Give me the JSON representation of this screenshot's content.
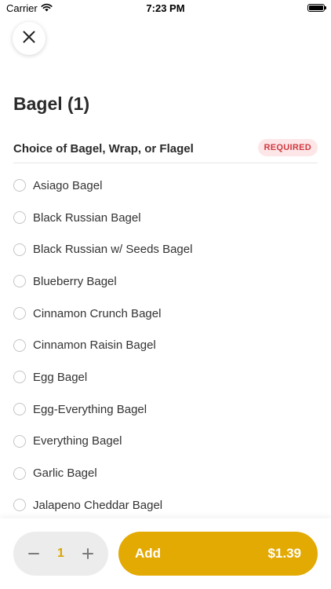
{
  "status_bar": {
    "carrier": "Carrier",
    "time": "7:23 PM",
    "icons": [
      "wifi-icon",
      "battery-icon"
    ]
  },
  "header": {
    "close_icon": "close-icon",
    "title": "Bagel (1)"
  },
  "section": {
    "label": "Choice of Bagel, Wrap, or Flagel",
    "badge": "REQUIRED"
  },
  "options": [
    {
      "label": "Asiago Bagel"
    },
    {
      "label": "Black Russian Bagel"
    },
    {
      "label": "Black Russian w/ Seeds Bagel"
    },
    {
      "label": "Blueberry Bagel"
    },
    {
      "label": "Cinnamon Crunch Bagel"
    },
    {
      "label": "Cinnamon Raisin Bagel"
    },
    {
      "label": "Egg Bagel"
    },
    {
      "label": "Egg-Everything Bagel"
    },
    {
      "label": "Everything Bagel"
    },
    {
      "label": "Garlic Bagel"
    },
    {
      "label": "Jalapeno Cheddar Bagel"
    }
  ],
  "footer": {
    "quantity": "1",
    "add_label": "Add",
    "price": "$1.39"
  },
  "colors": {
    "accent": "#e3aa04",
    "quantity_text": "#d9a400",
    "required_text": "#d0393f",
    "required_bg": "#fde6e8"
  }
}
